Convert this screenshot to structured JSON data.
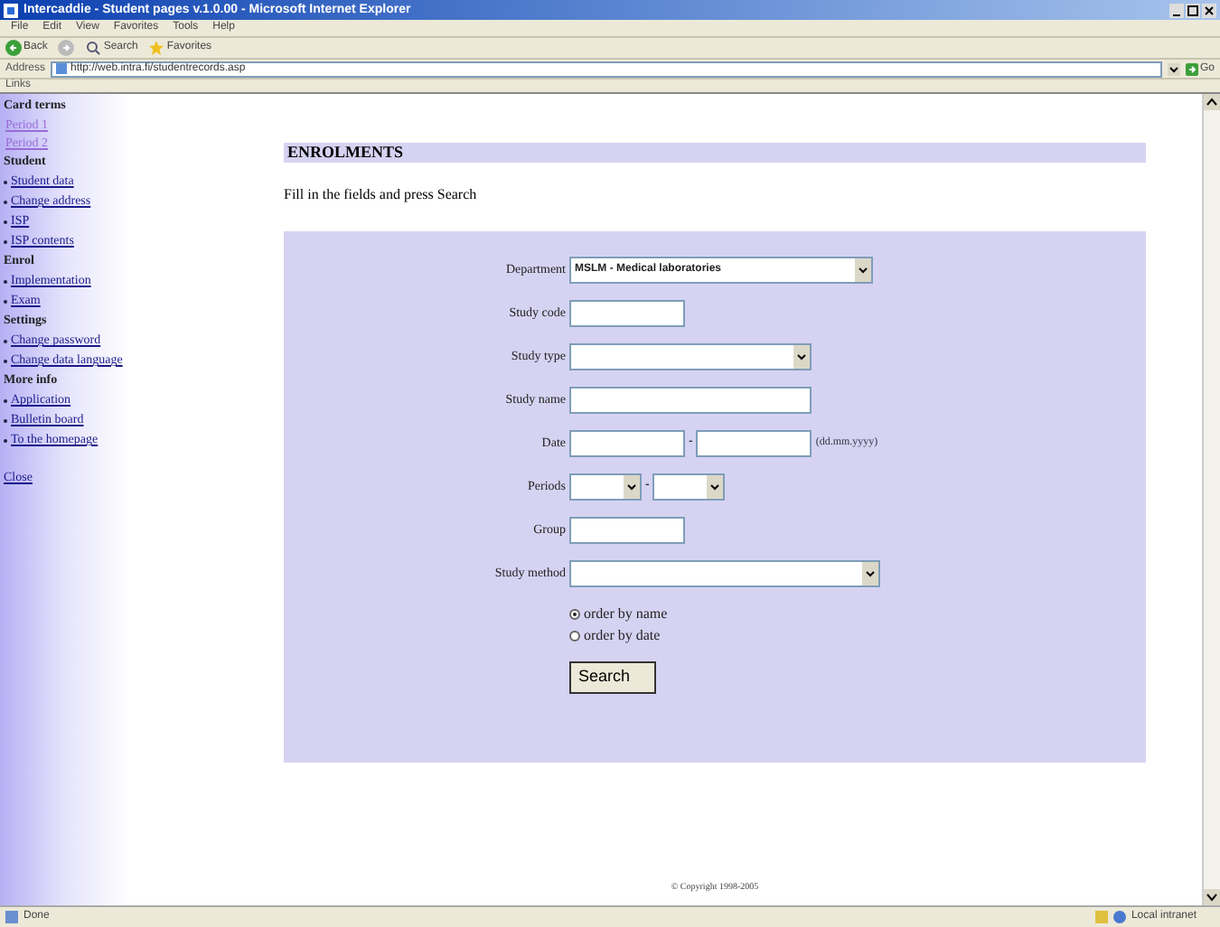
{
  "window": {
    "title": "Intercaddie - Student pages v.1.0.00 - Microsoft Internet Explorer"
  },
  "menu": [
    "File",
    "Edit",
    "View",
    "Favorites",
    "Tools",
    "Help"
  ],
  "toolbar": [
    {
      "kind": "back",
      "label": "Back"
    },
    {
      "kind": "forward"
    },
    {
      "kind": "search",
      "label": "Search"
    },
    {
      "kind": "favorites",
      "label": "Favorites"
    }
  ],
  "address": {
    "label": "Address",
    "value": "http://web.intra.fi/studentrecords.asp",
    "go": "Go"
  },
  "links_bar": {
    "label": "Links"
  },
  "sidebar": [
    {
      "kind": "heading",
      "label": "Card terms"
    },
    {
      "kind": "visited",
      "label": "Period 1"
    },
    {
      "kind": "visited",
      "label": "Period 2"
    },
    {
      "kind": "heading",
      "label": "Student"
    },
    {
      "kind": "link",
      "label": "Student data"
    },
    {
      "kind": "link",
      "label": "Change address"
    },
    {
      "kind": "link",
      "label": "ISP"
    },
    {
      "kind": "link",
      "label": "ISP contents"
    },
    {
      "kind": "heading",
      "label": "Enrol"
    },
    {
      "kind": "link",
      "label": "Implementation"
    },
    {
      "kind": "link",
      "label": "Exam"
    },
    {
      "kind": "heading",
      "label": "Settings"
    },
    {
      "kind": "link",
      "label": "Change password"
    },
    {
      "kind": "link",
      "label": "Change data language"
    },
    {
      "kind": "heading",
      "label": "More info"
    },
    {
      "kind": "link",
      "label": "Application"
    },
    {
      "kind": "link",
      "label": "Bulletin board"
    },
    {
      "kind": "link",
      "label": "To the homepage"
    },
    {
      "kind": "close",
      "label": "Close"
    }
  ],
  "page": {
    "heading": "ENROLMENTS",
    "instructions": "Fill in the fields and press Search"
  },
  "form": [
    {
      "kind": "select",
      "label": "Department",
      "value": "MSLM - Medical laboratories"
    },
    {
      "kind": "text",
      "label": "Study code"
    },
    {
      "kind": "select",
      "label": "Study type"
    },
    {
      "kind": "text",
      "label": "Study name"
    },
    {
      "kind": "range",
      "label": "Date",
      "separator": "-",
      "hint": "(dd.mm.yyyy)"
    },
    {
      "kind": "selects",
      "label": "Periods",
      "separator": "-"
    },
    {
      "kind": "text",
      "label": "Group"
    },
    {
      "kind": "select",
      "label": "Study method"
    }
  ],
  "sort": [
    {
      "label": "order by name",
      "selected": true
    },
    {
      "label": "order by date",
      "selected": false
    }
  ],
  "search_button": "Search",
  "footer": "© Copyright 1998-2005",
  "status_bar": {
    "text": "Done",
    "zone": "Local intranet"
  }
}
